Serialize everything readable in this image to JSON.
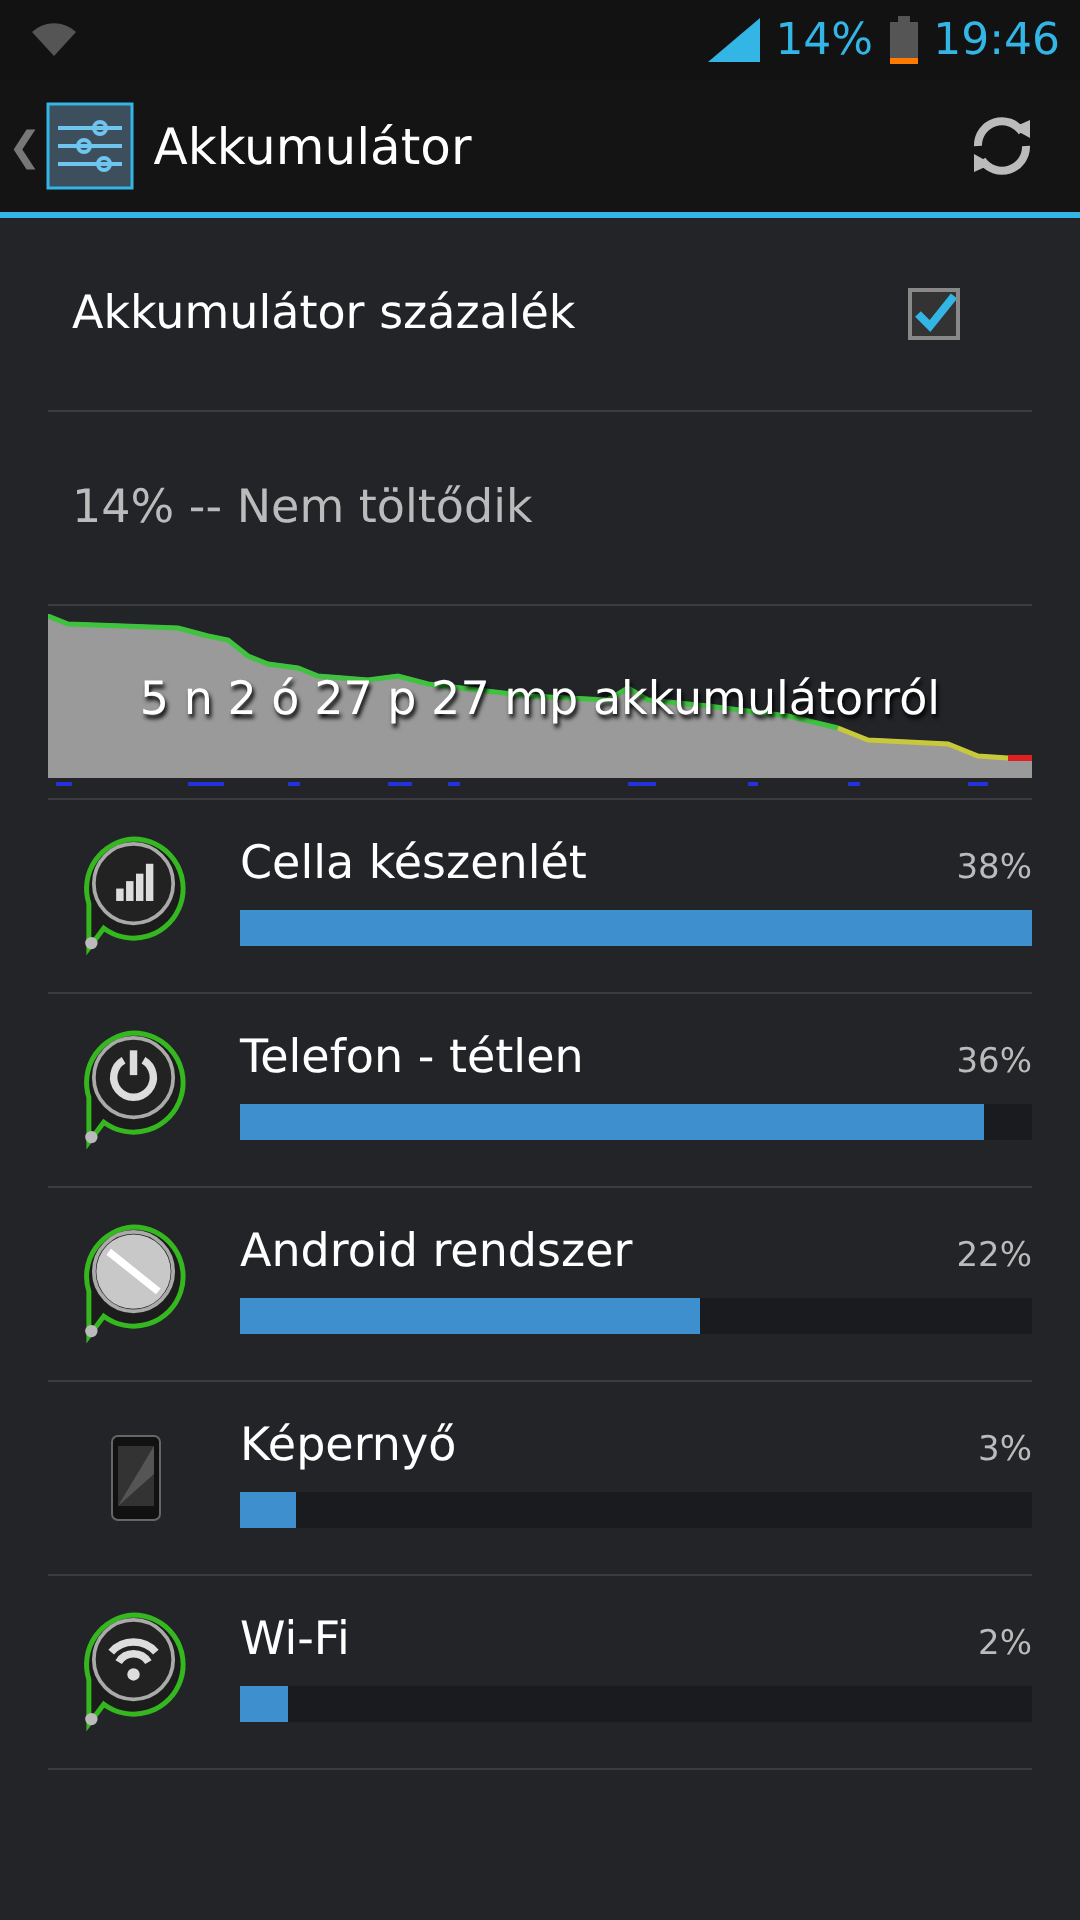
{
  "status_bar": {
    "battery_percent": "14%",
    "time": "19:46"
  },
  "action_bar": {
    "back": "❮",
    "title": "Akkumulátor"
  },
  "setting": {
    "label": "Akkumulátor százalék",
    "checked": true
  },
  "status_text": "14% -- Nem töltődik",
  "graph": {
    "caption": "5 n 2 ó 27 p 27 mp akkumulátorról"
  },
  "items": [
    {
      "kind": "signal",
      "name": "Cella készenlét",
      "percent": "38%",
      "level": 1.0
    },
    {
      "kind": "power",
      "name": "Telefon - tétlen",
      "percent": "36%",
      "level": 0.94
    },
    {
      "kind": "system",
      "name": "Android rendszer",
      "percent": "22%",
      "level": 0.58
    },
    {
      "kind": "phone",
      "name": "Képernyő",
      "percent": "3%",
      "level": 0.07
    },
    {
      "kind": "wifi",
      "name": "Wi-Fi",
      "percent": "2%",
      "level": 0.06
    }
  ]
}
